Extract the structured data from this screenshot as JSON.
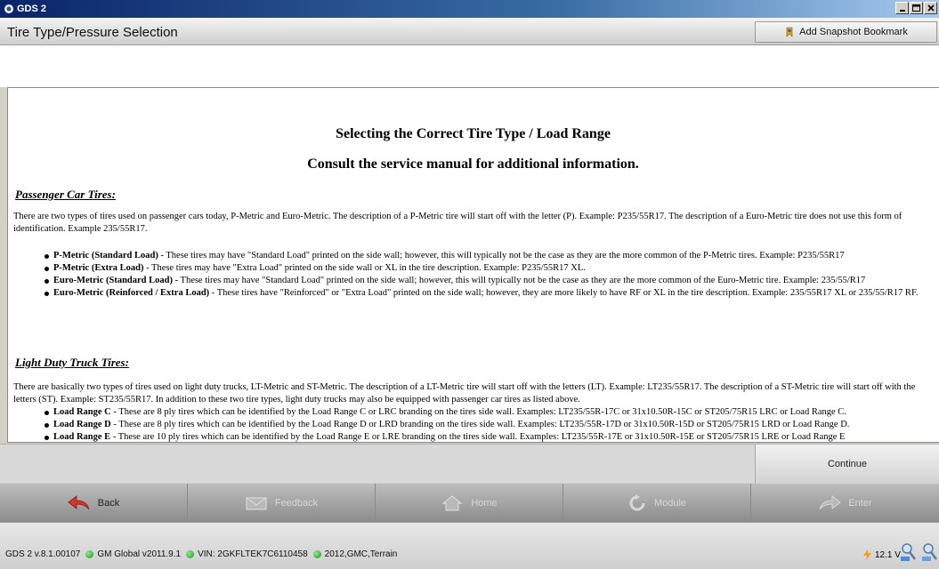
{
  "window": {
    "title": "GDS 2"
  },
  "header": {
    "page_title": "Tire Type/Pressure Selection",
    "snapshot_label": "Add Snapshot Bookmark"
  },
  "content": {
    "heading1": "Selecting the Correct Tire Type / Load Range",
    "heading2": "Consult the service manual for additional information.",
    "passenger": {
      "title": "Passenger Car Tires:",
      "intro": "There are two types of tires used on passenger cars today, P-Metric and Euro-Metric. The description of a P-Metric tire will start off with the letter (P). Example: P235/55R17. The description of a Euro-Metric tire does not use this form of identification. Example 235/55R17.",
      "items": [
        {
          "label": "P-Metric (Standard Load)",
          "text": " - These tires may have \"Standard Load\" printed on the side wall; however, this will typically not be the case as they are the more common of the P-Metric tires. Example: P235/55R17"
        },
        {
          "label": "P-Metric (Extra Load)",
          "text": " - These tires may have \"Extra Load\" printed on the side wall or XL in the tire description. Example: P235/55R17 XL."
        },
        {
          "label": "Euro-Metric (Standard Load)",
          "text": " - These tires may have \"Standard Load\" printed on the side wall; however, this will typically not be the case as they are the more common of the Euro-Metric tire. Example: 235/55/R17"
        },
        {
          "label": "Euro-Metric (Reinforced / Extra Load)",
          "text": " - These tires have \"Reinforced\" or \"Extra Load\" printed on the side wall; however, they are more likely to have RF or XL in the tire description. Example: 235/55R17 XL or 235/55/R17 RF."
        }
      ]
    },
    "truck": {
      "title": "Light Duty Truck Tires:",
      "intro": "There are basically two types of tires used on light duty trucks, LT-Metric and ST-Metric. The description of a LT-Metric tire will start off with the letters (LT). Example: LT235/55R17. The description of a ST-Metric tire will start off with the letters (ST). Example: ST235/55R17. In addition to these two tire types, light duty trucks may also be equipped with passenger car tires as listed above.",
      "items": [
        {
          "label": "Load Range C",
          "text": " - These are 8 ply tires which can be identified by the Load Range C or LRC branding on the tires side wall. Examples: LT235/55R-17C or 31x10.50R-15C or ST205/75R15 LRC or Load Range C."
        },
        {
          "label": "Load Range D",
          "text": " - These are 8 ply tires which can be identified by the Load Range D or LRD branding on the tires side wall. Examples: LT235/55R-17D or 31x10.50R-15D or ST205/75R15 LRD or Load Range D."
        },
        {
          "label": "Load Range E",
          "text": " - These are 10 ply tires which can be identified by the Load Range E or LRE branding on the tires side wall. Examples: LT235/55R-17E or 31x10.50R-15E or ST205/75R15 LRE or Load Range E"
        }
      ]
    }
  },
  "footer": {
    "continue_label": "Continue",
    "nav": {
      "back": "Back",
      "feedback": "Feedback",
      "home": "Home",
      "module": "Module",
      "enter": "Enter"
    }
  },
  "status": {
    "version": "GDS 2 v.8.1.00107",
    "global": "GM Global v2011.9.1",
    "vin": "VIN: 2GKFLTEK7C6110458",
    "vehicle": "2012,GMC,Terrain",
    "voltage": "12.1 V"
  },
  "colors": {
    "titlebar": "#0a246a",
    "status_ok": "#1a9a1a",
    "back_arrow": "#d8322c"
  }
}
